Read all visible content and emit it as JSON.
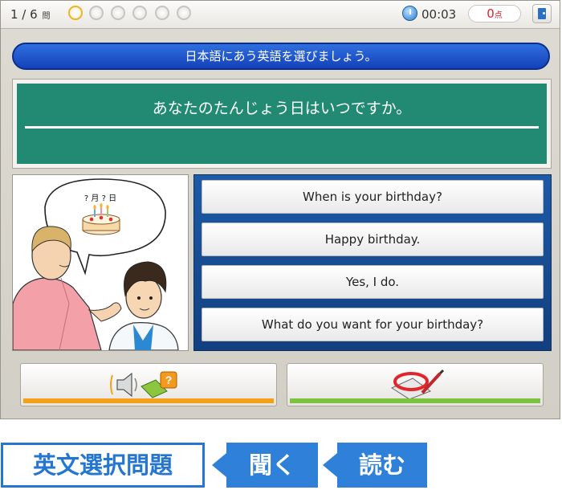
{
  "topbar": {
    "question_num": "1 / 6",
    "question_unit": "問",
    "progress_total": 6,
    "progress_current": 1,
    "timer": "00:03",
    "score_value": "0",
    "score_unit": "点"
  },
  "instruction": "日本語にあう英語を選びましょう。",
  "question": {
    "text": "あなたのたんじょう日はいつですか。"
  },
  "illustration": {
    "bubble_text": "? 月 ? 日"
  },
  "choices": [
    "When is your birthday?",
    "Happy birthday.",
    "Yes, I do.",
    "What do you want for your birthday?"
  ],
  "bottom_buttons": {
    "listen_icon": "speaker-hint-icon",
    "answer_icon": "check-answer-icon"
  },
  "tags": {
    "main": "英文選択問題",
    "listen": "聞く",
    "read": "読む"
  },
  "colors": {
    "question_panel": "#228a73",
    "choices_bg": "#1d5aa8",
    "instruction_bg": "#1a4ec6",
    "tag_blue": "#2f80d9",
    "listen_bar": "#f5a01a",
    "answer_bar": "#7cc340"
  }
}
